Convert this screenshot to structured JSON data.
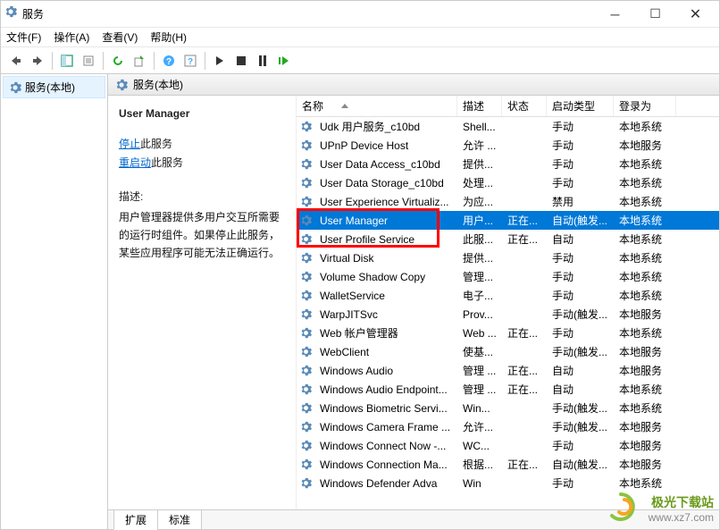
{
  "window": {
    "title": "服务"
  },
  "menu": {
    "file": "文件(F)",
    "action": "操作(A)",
    "view": "查看(V)",
    "help": "帮助(H)"
  },
  "left": {
    "root": "服务(本地)"
  },
  "right_header": {
    "label": "服务(本地)"
  },
  "detail": {
    "selected_name": "User Manager",
    "stop_link": "停止",
    "stop_suffix": "此服务",
    "restart_link": "重启动",
    "restart_suffix": "此服务",
    "desc_label": "描述:",
    "desc_body": "用户管理器提供多用户交互所需要的运行时组件。如果停止此服务，某些应用程序可能无法正确运行。"
  },
  "columns": {
    "name": "名称",
    "desc": "描述",
    "status": "状态",
    "startup": "启动类型",
    "logon": "登录为"
  },
  "tabs": {
    "ext": "扩展",
    "std": "标准"
  },
  "watermark": {
    "line1": "极光下载站",
    "line2": "www.xz7.com"
  },
  "rows": [
    {
      "name": "Udk 用户服务_c10bd",
      "desc": "Shell...",
      "status": "",
      "startup": "手动",
      "logon": "本地系统",
      "sel": false
    },
    {
      "name": "UPnP Device Host",
      "desc": "允许 ...",
      "status": "",
      "startup": "手动",
      "logon": "本地服务",
      "sel": false
    },
    {
      "name": "User Data Access_c10bd",
      "desc": "提供...",
      "status": "",
      "startup": "手动",
      "logon": "本地系统",
      "sel": false
    },
    {
      "name": "User Data Storage_c10bd",
      "desc": "处理...",
      "status": "",
      "startup": "手动",
      "logon": "本地系统",
      "sel": false
    },
    {
      "name": "User Experience Virtualiz...",
      "desc": "为应...",
      "status": "",
      "startup": "禁用",
      "logon": "本地系统",
      "sel": false
    },
    {
      "name": "User Manager",
      "desc": "用户...",
      "status": "正在...",
      "startup": "自动(触发...",
      "logon": "本地系统",
      "sel": true
    },
    {
      "name": "User Profile Service",
      "desc": "此服...",
      "status": "正在...",
      "startup": "自动",
      "logon": "本地系统",
      "sel": false
    },
    {
      "name": "Virtual Disk",
      "desc": "提供...",
      "status": "",
      "startup": "手动",
      "logon": "本地系统",
      "sel": false
    },
    {
      "name": "Volume Shadow Copy",
      "desc": "管理...",
      "status": "",
      "startup": "手动",
      "logon": "本地系统",
      "sel": false
    },
    {
      "name": "WalletService",
      "desc": "电子...",
      "status": "",
      "startup": "手动",
      "logon": "本地系统",
      "sel": false
    },
    {
      "name": "WarpJITSvc",
      "desc": "Prov...",
      "status": "",
      "startup": "手动(触发...",
      "logon": "本地服务",
      "sel": false
    },
    {
      "name": "Web 帐户管理器",
      "desc": "Web ...",
      "status": "正在...",
      "startup": "手动",
      "logon": "本地系统",
      "sel": false
    },
    {
      "name": "WebClient",
      "desc": "使基...",
      "status": "",
      "startup": "手动(触发...",
      "logon": "本地服务",
      "sel": false
    },
    {
      "name": "Windows Audio",
      "desc": "管理 ...",
      "status": "正在...",
      "startup": "自动",
      "logon": "本地服务",
      "sel": false
    },
    {
      "name": "Windows Audio Endpoint...",
      "desc": "管理 ...",
      "status": "正在...",
      "startup": "自动",
      "logon": "本地系统",
      "sel": false
    },
    {
      "name": "Windows Biometric Servi...",
      "desc": "Win...",
      "status": "",
      "startup": "手动(触发...",
      "logon": "本地系统",
      "sel": false
    },
    {
      "name": "Windows Camera Frame ...",
      "desc": "允许...",
      "status": "",
      "startup": "手动(触发...",
      "logon": "本地服务",
      "sel": false
    },
    {
      "name": "Windows Connect Now -...",
      "desc": "WC...",
      "status": "",
      "startup": "手动",
      "logon": "本地服务",
      "sel": false
    },
    {
      "name": "Windows Connection Ma...",
      "desc": "根据...",
      "status": "正在...",
      "startup": "自动(触发...",
      "logon": "本地服务",
      "sel": false
    },
    {
      "name": "Windows Defender Adva",
      "desc": "Win",
      "status": "",
      "startup": "手动",
      "logon": "本地系统",
      "sel": false
    }
  ]
}
